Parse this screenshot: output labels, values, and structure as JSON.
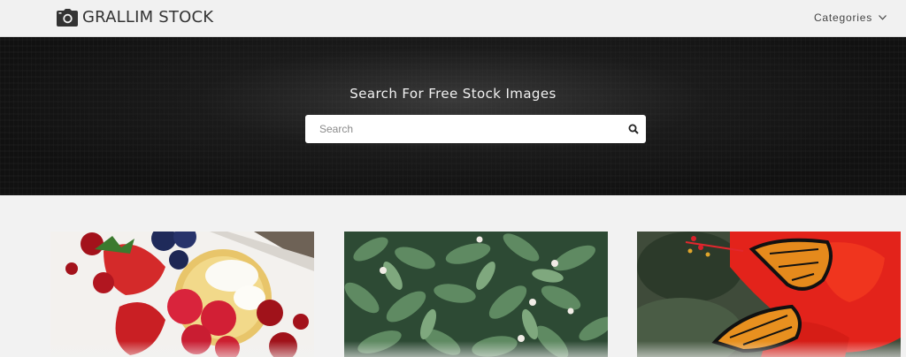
{
  "header": {
    "brand": "GRALLIM STOCK",
    "logo_icon": "camera-icon",
    "nav": {
      "categories_label": "Categories",
      "icon": "chevron-down-icon"
    }
  },
  "hero": {
    "title": "Search For Free Stock Images",
    "search": {
      "placeholder": "Search",
      "value": "",
      "button_icon": "search-icon"
    }
  },
  "gallery": {
    "images": [
      {
        "subject": "dessert-tart-with-berries"
      },
      {
        "subject": "green-leaves-with-white-flowers"
      },
      {
        "subject": "monarch-butterflies-on-red-hibiscus"
      }
    ]
  },
  "colors": {
    "header_bg": "#f1f1f1",
    "hero_bg": "#111111",
    "page_bg": "#f2f2f2",
    "text_dark": "#333333"
  }
}
